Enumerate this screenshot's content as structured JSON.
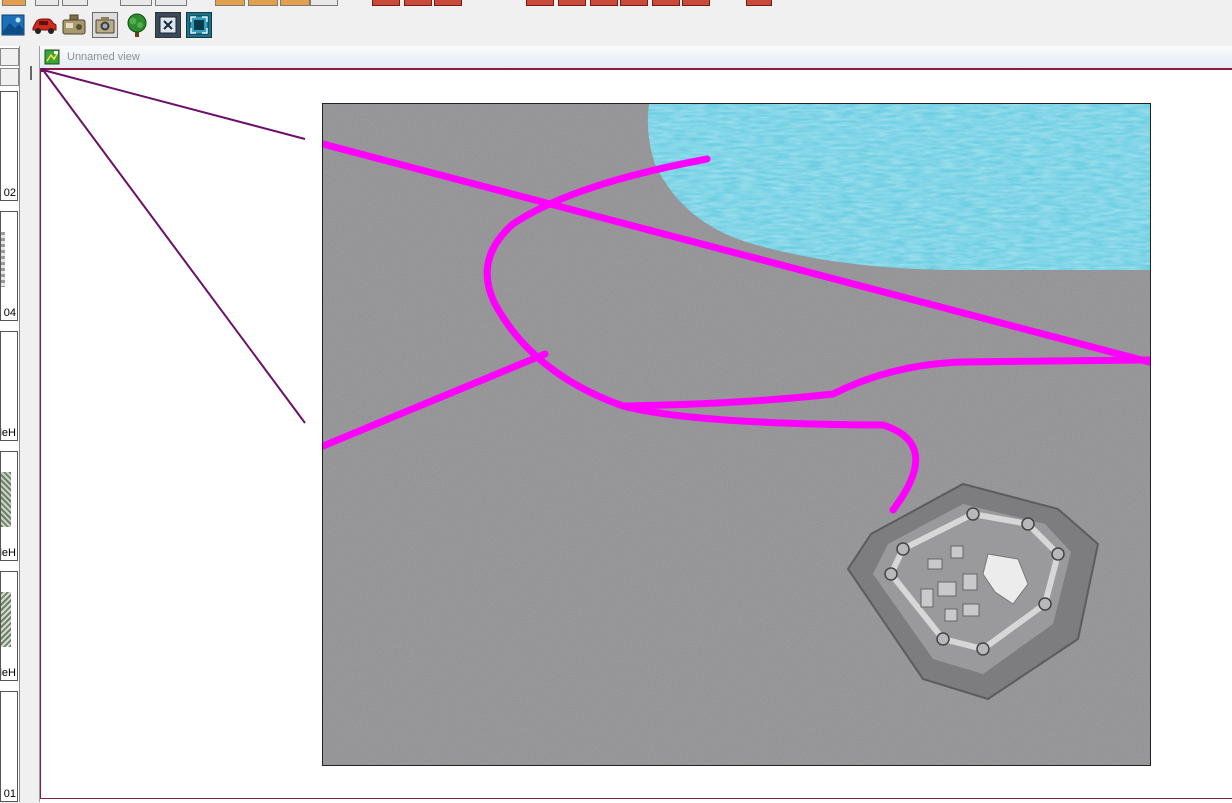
{
  "view": {
    "title": "Unnamed view"
  },
  "left_panel": {
    "thumbnail_labels": [
      "02",
      "04",
      "leH",
      "leH",
      "leH",
      "01"
    ]
  },
  "toolbar_icons": [
    "map-image-icon",
    "red-car-icon",
    "radio-device-icon",
    "camera-icon",
    "tree-icon",
    "close-frame-icon",
    "fit-view-icon"
  ],
  "colors": {
    "road": "#ff00ff",
    "water": "#5ec8de",
    "ground": "#8d8c8e",
    "view_frame": "#8c1b3c"
  }
}
